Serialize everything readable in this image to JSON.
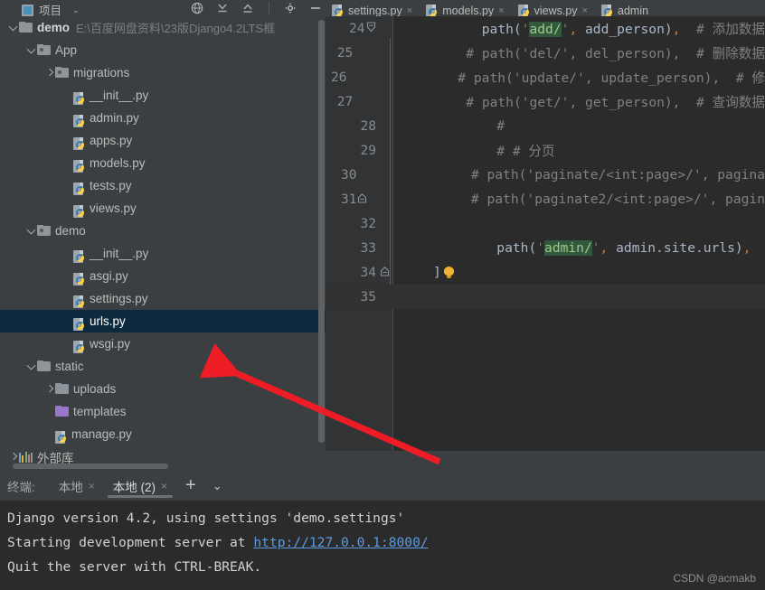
{
  "toolwindow": {
    "title": "项目",
    "icon": "project-icon",
    "dropdown_caret": "⌄",
    "actions": [
      "globe-icon",
      "collapse-all-icon",
      "expand-all-icon",
      "settings-gear-icon",
      "minimize-icon"
    ]
  },
  "tree": [
    {
      "depth": 0,
      "arrow": "down",
      "icon": "folder",
      "label": "demo",
      "bold": true,
      "path": "E:\\百度网盘资料\\23版Django4.2LTS框",
      "selected": false
    },
    {
      "depth": 1,
      "arrow": "down",
      "icon": "folder-module",
      "label": "App",
      "bold": false,
      "path": "",
      "selected": false
    },
    {
      "depth": 2,
      "arrow": "right",
      "icon": "folder-module",
      "label": "migrations",
      "bold": false,
      "path": "",
      "selected": false
    },
    {
      "depth": 3,
      "arrow": "none",
      "icon": "python-file",
      "label": "__init__.py",
      "bold": false,
      "path": "",
      "selected": false
    },
    {
      "depth": 3,
      "arrow": "none",
      "icon": "python-file",
      "label": "admin.py",
      "bold": false,
      "path": "",
      "selected": false
    },
    {
      "depth": 3,
      "arrow": "none",
      "icon": "python-file",
      "label": "apps.py",
      "bold": false,
      "path": "",
      "selected": false
    },
    {
      "depth": 3,
      "arrow": "none",
      "icon": "python-file",
      "label": "models.py",
      "bold": false,
      "path": "",
      "selected": false
    },
    {
      "depth": 3,
      "arrow": "none",
      "icon": "python-file",
      "label": "tests.py",
      "bold": false,
      "path": "",
      "selected": false
    },
    {
      "depth": 3,
      "arrow": "none",
      "icon": "python-file",
      "label": "views.py",
      "bold": false,
      "path": "",
      "selected": false
    },
    {
      "depth": 1,
      "arrow": "down",
      "icon": "folder-module",
      "label": "demo",
      "bold": false,
      "path": "",
      "selected": false
    },
    {
      "depth": 3,
      "arrow": "none",
      "icon": "python-file",
      "label": "__init__.py",
      "bold": false,
      "path": "",
      "selected": false
    },
    {
      "depth": 3,
      "arrow": "none",
      "icon": "python-file",
      "label": "asgi.py",
      "bold": false,
      "path": "",
      "selected": false
    },
    {
      "depth": 3,
      "arrow": "none",
      "icon": "python-file",
      "label": "settings.py",
      "bold": false,
      "path": "",
      "selected": false
    },
    {
      "depth": 3,
      "arrow": "none",
      "icon": "python-file",
      "label": "urls.py",
      "bold": false,
      "path": "",
      "selected": true
    },
    {
      "depth": 3,
      "arrow": "none",
      "icon": "python-file",
      "label": "wsgi.py",
      "bold": false,
      "path": "",
      "selected": false
    },
    {
      "depth": 1,
      "arrow": "down",
      "icon": "folder",
      "label": "static",
      "bold": false,
      "path": "",
      "selected": false
    },
    {
      "depth": 2,
      "arrow": "right",
      "icon": "folder",
      "label": "uploads",
      "bold": false,
      "path": "",
      "selected": false
    },
    {
      "depth": 2,
      "arrow": "none",
      "icon": "folder-purple",
      "label": "templates",
      "bold": false,
      "path": "",
      "selected": false
    },
    {
      "depth": 2,
      "arrow": "none",
      "icon": "python-file",
      "label": "manage.py",
      "bold": false,
      "path": "",
      "selected": false
    },
    {
      "depth": 0,
      "arrow": "right",
      "icon": "library",
      "label": "外部库",
      "bold": false,
      "path": "",
      "selected": false
    }
  ],
  "tabs": [
    {
      "label": "settings.py",
      "close": "×",
      "active": false
    },
    {
      "label": "models.py",
      "close": "×",
      "active": false
    },
    {
      "label": "views.py",
      "close": "×",
      "active": false
    },
    {
      "label": "admin",
      "close": "",
      "active": false
    }
  ],
  "editor": {
    "lines": [
      {
        "num": "24",
        "fold": "fold-collapse-arrow",
        "segments": [
          {
            "t": "        ",
            "c": "c-plain"
          },
          {
            "t": "path(",
            "c": "c-plain"
          },
          {
            "t": "'",
            "c": "c-str"
          },
          {
            "t": "add/",
            "c": "c-hl"
          },
          {
            "t": "'",
            "c": "c-str"
          },
          {
            "t": ",",
            "c": "c-punc"
          },
          {
            "t": " add_person)",
            "c": "c-plain"
          },
          {
            "t": ",",
            "c": "c-punc"
          },
          {
            "t": "  # 添加数据",
            "c": "c-com"
          }
        ]
      },
      {
        "num": "25",
        "fold": "",
        "segments": [
          {
            "t": "        # path('del/', del_person),  # 删除数据",
            "c": "c-com"
          }
        ]
      },
      {
        "num": "26",
        "fold": "",
        "segments": [
          {
            "t": "        # path('update/', update_person),  # 修",
            "c": "c-com"
          }
        ]
      },
      {
        "num": "27",
        "fold": "",
        "segments": [
          {
            "t": "        # path('get/', get_person),  # 查询数据",
            "c": "c-com"
          }
        ]
      },
      {
        "num": "28",
        "fold": "",
        "segments": [
          {
            "t": "        #",
            "c": "c-com"
          }
        ]
      },
      {
        "num": "29",
        "fold": "",
        "segments": [
          {
            "t": "        # # 分页",
            "c": "c-com"
          }
        ]
      },
      {
        "num": "30",
        "fold": "",
        "segments": [
          {
            "t": "        # path('paginate/<int:page>/', pagina",
            "c": "c-com"
          }
        ]
      },
      {
        "num": "31",
        "fold": "fold-marker",
        "segments": [
          {
            "t": "        # path('paginate2/<int:page>/', pagin",
            "c": "c-com"
          }
        ]
      },
      {
        "num": "32",
        "fold": "",
        "segments": []
      },
      {
        "num": "33",
        "fold": "",
        "segments": [
          {
            "t": "        ",
            "c": "c-plain"
          },
          {
            "t": "path(",
            "c": "c-plain"
          },
          {
            "t": "'",
            "c": "c-str"
          },
          {
            "t": "admin/",
            "c": "c-hl"
          },
          {
            "t": "'",
            "c": "c-str"
          },
          {
            "t": ",",
            "c": "c-punc"
          },
          {
            "t": " admin.site.urls)",
            "c": "c-plain"
          },
          {
            "t": ",",
            "c": "c-punc"
          }
        ]
      },
      {
        "num": "34",
        "fold": "fold-marker",
        "segments": [
          {
            "t": "]",
            "c": "c-plain"
          }
        ],
        "bulb": true
      },
      {
        "num": "35",
        "fold": "",
        "segments": [],
        "current": true
      }
    ]
  },
  "terminal": {
    "title": "终端:",
    "tabs": [
      {
        "label": "本地",
        "close": "×",
        "active": false
      },
      {
        "label": "本地 (2)",
        "close": "×",
        "active": true
      }
    ],
    "add_label": "+",
    "dropdown_label": "⌄",
    "output": [
      {
        "pre": "Django version 4.2, using settings 'demo.settings'",
        "link": "",
        "post": ""
      },
      {
        "pre": "Starting development server at ",
        "link": "http://127.0.0.1:8000/",
        "post": ""
      },
      {
        "pre": "Quit the server with CTRL-BREAK.",
        "link": "",
        "post": ""
      }
    ]
  },
  "watermark": "CSDN @acmakb",
  "colors": {
    "selection_blue": "#0d293e",
    "string_green": "#6a8759",
    "highlight_green": "#32593d",
    "comment_gray": "#808080",
    "annotation_red": "#ee1c25",
    "link_blue": "#5d9ae0"
  }
}
